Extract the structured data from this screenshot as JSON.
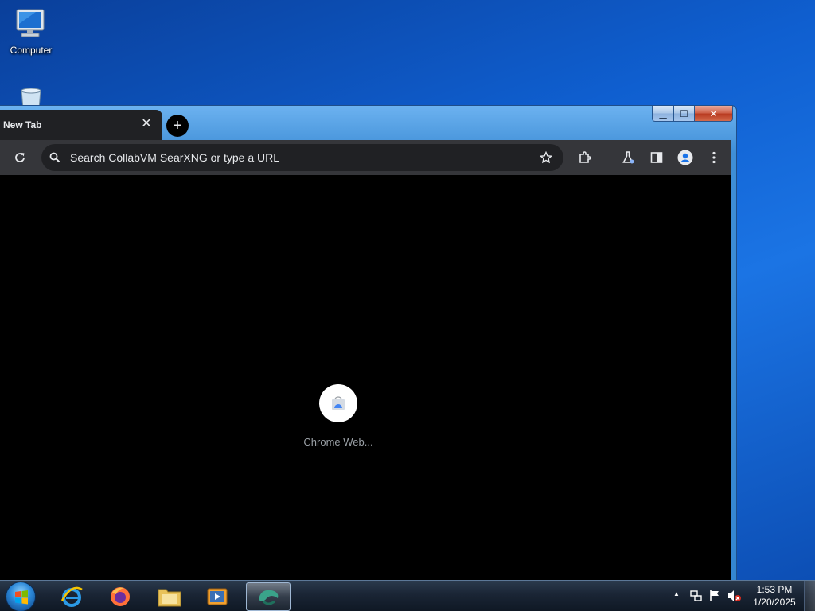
{
  "desktop": {
    "icons": [
      {
        "label": "Computer",
        "icon": "computer-icon"
      },
      {
        "label": "",
        "icon": "recycle-bin-icon"
      }
    ]
  },
  "browser": {
    "tab": {
      "title": "New Tab",
      "close_glyph": "✕"
    },
    "new_tab_glyph": "+",
    "window_controls": {
      "minimize": "▁",
      "maximize": "☐",
      "close": "✕"
    },
    "omnibox": {
      "placeholder": "Search CollabVM SearXNG or type a URL"
    },
    "content": {
      "loading_label": "Chrome Web..."
    }
  },
  "taskbar": {
    "apps": [
      {
        "name": "internet-explorer-icon"
      },
      {
        "name": "firefox-icon"
      },
      {
        "name": "file-explorer-icon"
      },
      {
        "name": "media-player-icon"
      },
      {
        "name": "chrome-icon",
        "active": true
      }
    ],
    "tray": {
      "expand_glyph": "▲"
    },
    "clock": {
      "time": "1:53 PM",
      "date": "1/20/2025"
    }
  },
  "colors": {
    "desktop_blue": "#1467d1",
    "chrome_dark": "#202124",
    "toolbar": "#35363a",
    "window_frame": "#3486d1"
  }
}
